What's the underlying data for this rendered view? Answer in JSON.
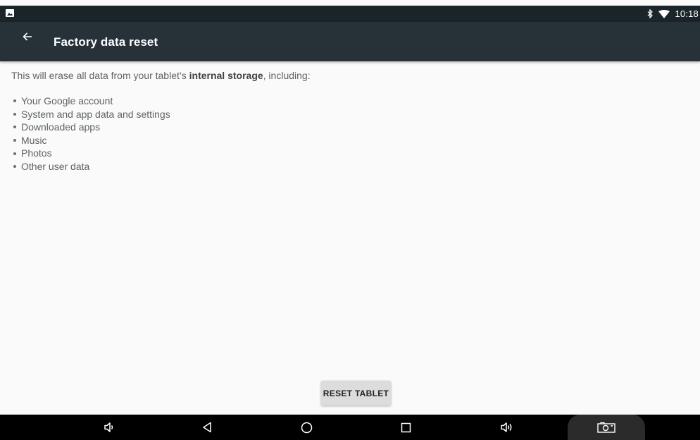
{
  "status_bar": {
    "time": "10:18",
    "icons": [
      "image-notification-icon",
      "bluetooth-icon",
      "wifi-icon"
    ]
  },
  "toolbar": {
    "back_icon": "arrow-back-icon",
    "title": "Factory data reset"
  },
  "content": {
    "intro_prefix": "This will erase all data from your tablet’s ",
    "intro_bold": "internal storage",
    "intro_suffix": ", including:",
    "items": [
      "Your Google account",
      "System and app data and settings",
      "Downloaded apps",
      "Music",
      "Photos",
      "Other user data"
    ]
  },
  "reset_button": {
    "label": "RESET TABLET"
  },
  "nav_bar": {
    "icons": [
      "volume-down-icon",
      "back-icon",
      "home-icon",
      "recents-icon",
      "volume-up-icon",
      "screenshot-icon"
    ]
  },
  "colors": {
    "toolbar": "#263238",
    "status_bar": "#1b2428",
    "background": "#fafafa",
    "button": "#dcdcdc",
    "nav_bar": "#000000"
  }
}
